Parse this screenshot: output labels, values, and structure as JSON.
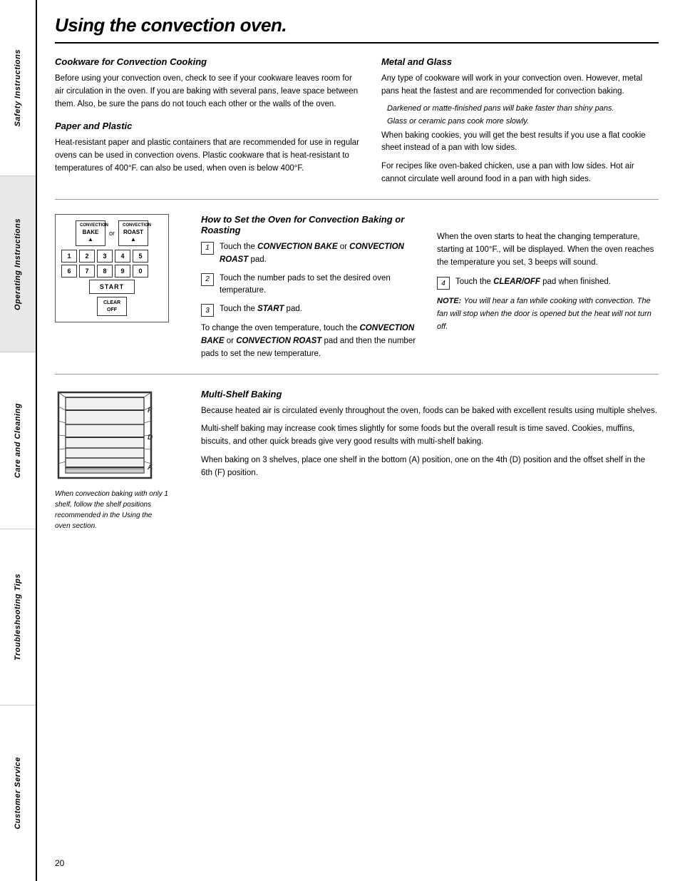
{
  "sidebar": {
    "tabs": [
      {
        "label": "Safety Instructions"
      },
      {
        "label": "Operating Instructions"
      },
      {
        "label": "Care and Cleaning"
      },
      {
        "label": "Troubleshooting Tips"
      },
      {
        "label": "Customer Service"
      }
    ]
  },
  "page": {
    "title": "Using the convection oven.",
    "number": "20",
    "sections": {
      "cookware": {
        "title": "Cookware for Convection Cooking",
        "body": "Before using your convection oven, check to see if your cookware leaves room for air circulation in the oven. If you are baking with several pans, leave space between them. Also, be sure the pans do not touch each other or the walls of the oven."
      },
      "paper_plastic": {
        "title": "Paper and Plastic",
        "body": "Heat-resistant paper and plastic containers that are recommended for use in regular ovens can be used in convection ovens. Plastic cookware that is heat-resistant to temperatures of 400°F. can also be used, when oven is below 400°F."
      },
      "metal_glass": {
        "title": "Metal and Glass",
        "body1": "Any type of cookware will work in your convection oven. However, metal pans heat the fastest and are recommended for convection baking.",
        "note1": "Darkened or matte-finished pans will bake faster than shiny pans.",
        "note2": "Glass or ceramic pans cook more slowly.",
        "body2": "When baking cookies, you will get the best results if you use a flat cookie sheet instead of a pan with low sides.",
        "body3": "For recipes like oven-baked chicken, use a pan with low sides. Hot air cannot circulate well around food in a pan with high sides."
      },
      "how_to": {
        "title": "How to Set the Oven for Convection Baking or Roasting",
        "steps": [
          {
            "num": "1",
            "text_prefix": "Touch the ",
            "bold": "CONVECTION BAKE",
            "text_mid": " or ",
            "bold2": "CONVECTION ROAST",
            "text_suffix": " pad."
          },
          {
            "num": "2",
            "text": "Touch the number pads to set the desired oven temperature."
          },
          {
            "num": "3",
            "text_prefix": "Touch the ",
            "bold": "START",
            "text_suffix": " pad."
          }
        ],
        "change_temp": "To change the oven temperature, touch the CONVECTION BAKE or CONVECTION ROAST pad and then the number pads to set the new temperature.",
        "right_text": "When the oven starts to heat the changing temperature, starting at 100°F., will be displayed. When the oven reaches the temperature you set, 3 beeps will sound.",
        "step4_prefix": "Touch the ",
        "step4_bold": "CLEAR/OFF",
        "step4_suffix": " pad when finished.",
        "note_bold": "NOTE:",
        "note_text": " You will hear a fan while cooking with convection. The fan will stop when the door is opened but the heat will not turn off."
      },
      "multi_shelf": {
        "title": "Multi-Shelf Baking",
        "body1": "Because heated air is circulated evenly throughout the oven, foods can be baked with excellent results using multiple shelves.",
        "body2": "Multi-shelf baking may increase cook times slightly for some foods but the overall result is time saved. Cookies, muffins, biscuits, and other quick breads give very good results with multi-shelf baking.",
        "body3": "When baking on 3 shelves, place one shelf in the bottom (A) position, one on the 4th (D) position and the offset shelf in the 6th (F) position.",
        "caption": "When convection baking with only 1 shelf, follow the shelf positions recommended in the Using the oven section."
      }
    },
    "keypad": {
      "convection_bake": "CONVECTION\nBAKE",
      "convection_roast": "CONVECTION\nROAST",
      "or": "or",
      "numbers": [
        "1",
        "2",
        "3",
        "4",
        "5",
        "6",
        "7",
        "8",
        "9",
        "0"
      ],
      "start": "START",
      "clear": "CLEAR\nOFF"
    }
  }
}
